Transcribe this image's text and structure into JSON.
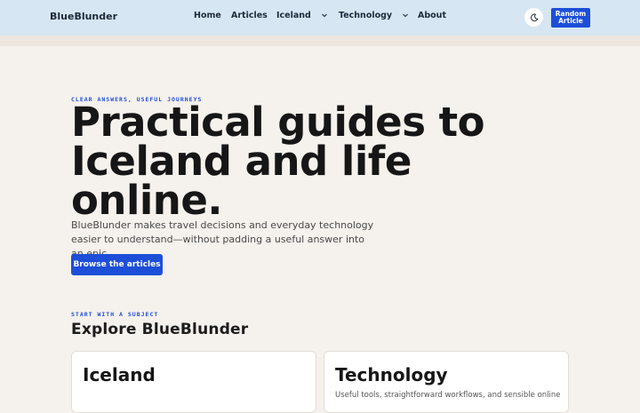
{
  "header": {
    "brand": "BlueBlunder",
    "nav": [
      {
        "label": "Home"
      },
      {
        "label": "Articles"
      },
      {
        "label": "Iceland",
        "dropdown": true
      },
      {
        "label": "Technology",
        "dropdown": true
      },
      {
        "label": "About"
      }
    ],
    "theme_icon": "moon-icon",
    "random_button": "Random Article"
  },
  "hero": {
    "eyebrow": "CLEAR ANSWERS, USEFUL JOURNEYS",
    "title": "Practical guides to Iceland and life online.",
    "text": "BlueBlunder makes travel decisions and everyday technology easier to understand—without padding a useful answer into an epic.",
    "cta": "Browse the articles"
  },
  "subjects": {
    "eyebrow": "START WITH A SUBJECT",
    "title": "Explore BlueBlunder",
    "cards": [
      {
        "title": "Iceland",
        "text": ""
      },
      {
        "title": "Technology",
        "text": "Useful tools, straightforward workflows, and sensible online"
      }
    ]
  },
  "colors": {
    "accent": "#1d4ed8",
    "header_bg": "#d6e6f3",
    "page_bg": "#f5f1ec"
  }
}
